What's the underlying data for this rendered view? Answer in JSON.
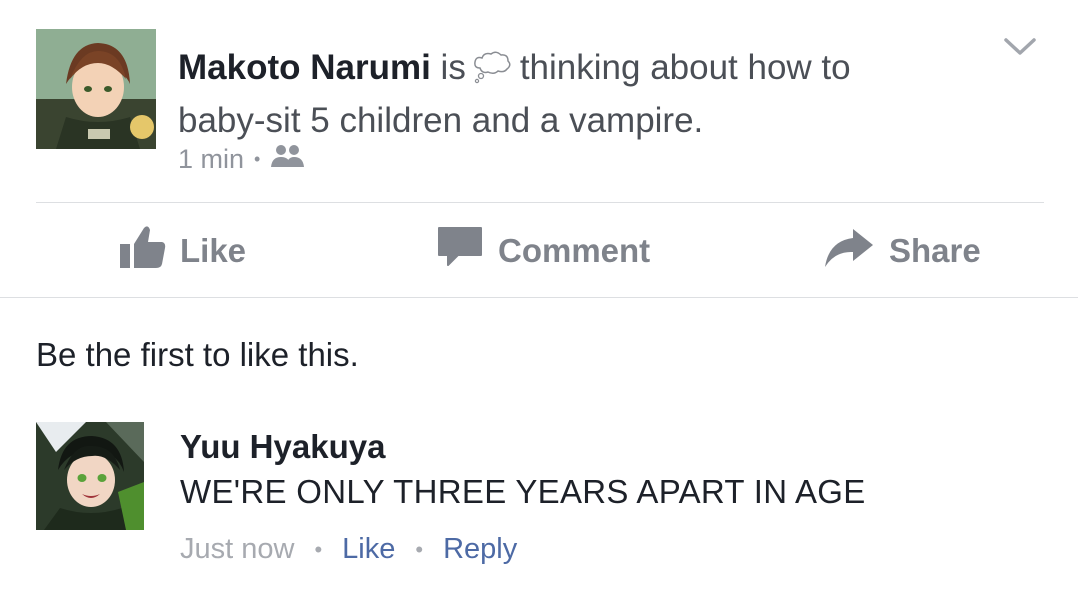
{
  "post": {
    "author": "Makoto Narumi",
    "verb": "is",
    "status_line1": "thinking about how to",
    "status_line2": "baby-sit 5 children and a vampire.",
    "time": "1 min",
    "separator": "•",
    "audience_icon": "friends-icon",
    "status_icon": "thought-bubble-icon"
  },
  "actions": {
    "like": "Like",
    "comment": "Comment",
    "share": "Share"
  },
  "likes_summary": "Be the first to like this.",
  "comment": {
    "author": "Yuu Hyakuya",
    "text": "WE'RE ONLY THREE YEARS APART IN AGE",
    "time": "Just now",
    "dot": "•",
    "like": "Like",
    "reply": "Reply"
  },
  "colors": {
    "action_gray": "#7f838b",
    "link_blue": "#4d6aa5",
    "meta_gray": "#90949c"
  }
}
